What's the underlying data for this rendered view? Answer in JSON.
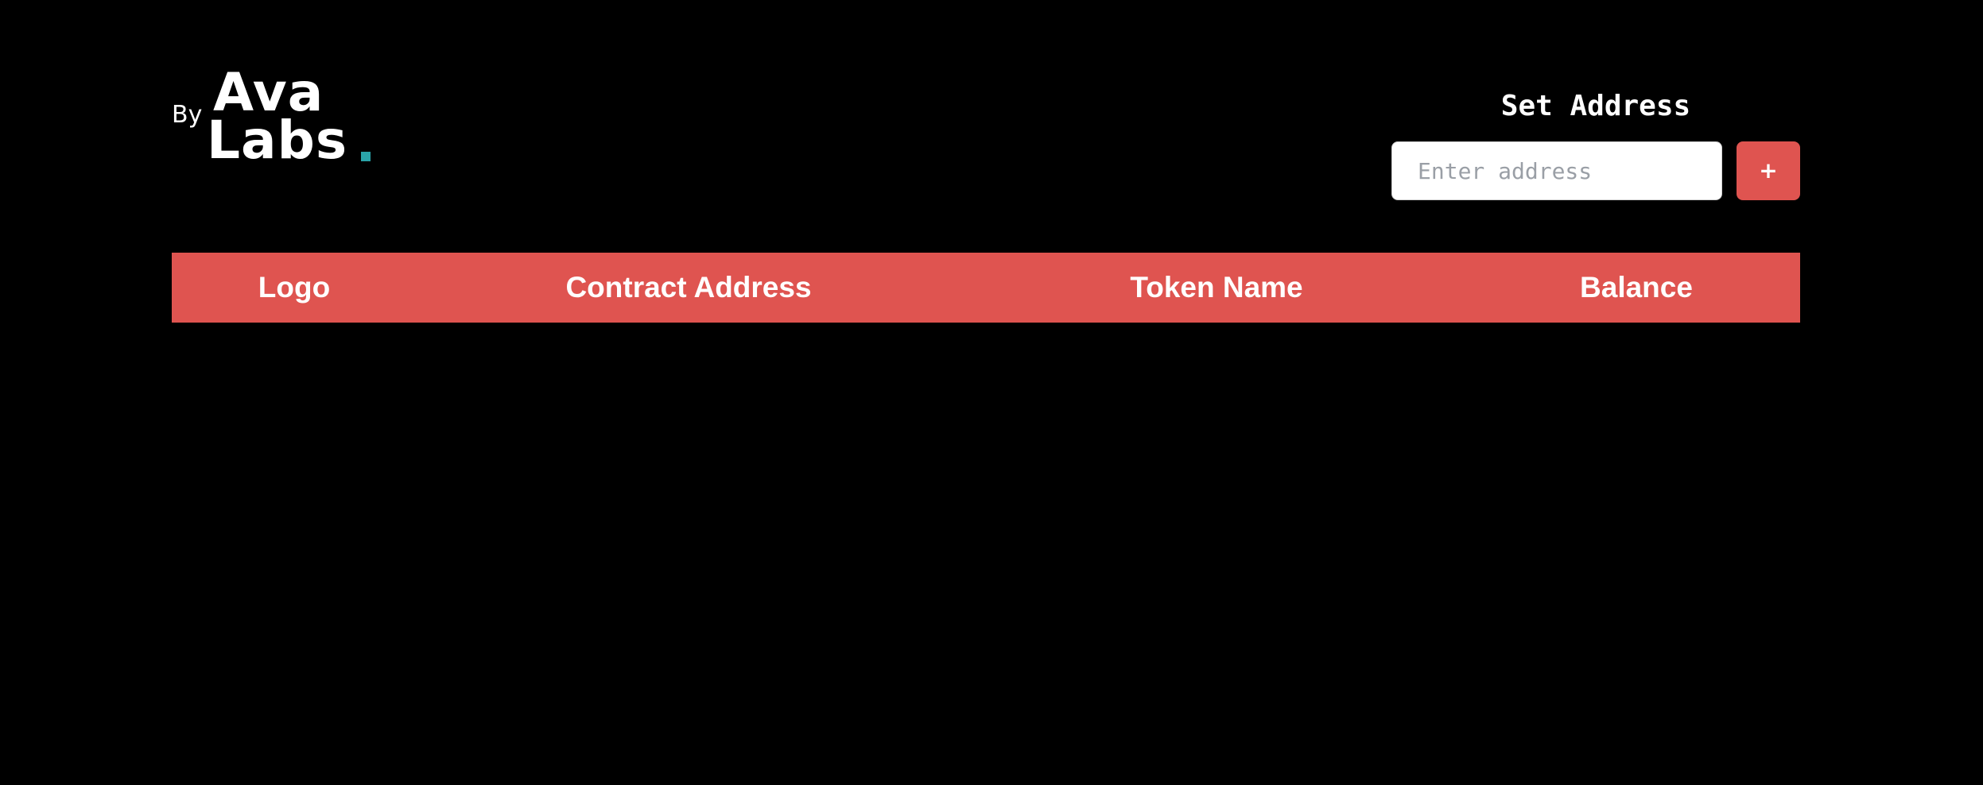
{
  "brand": {
    "by": "By",
    "word_line1": "Ava",
    "word_line2": "Labs",
    "accent_color": "#2aa3a8"
  },
  "set_address": {
    "title": "Set Address",
    "input_placeholder": "Enter address",
    "input_value": "",
    "add_button_label": "+"
  },
  "table": {
    "columns": [
      "Logo",
      "Contract Address",
      "Token Name",
      "Balance"
    ],
    "rows": []
  },
  "colors": {
    "background": "#000000",
    "accent": "#df5450",
    "text": "#ffffff"
  }
}
